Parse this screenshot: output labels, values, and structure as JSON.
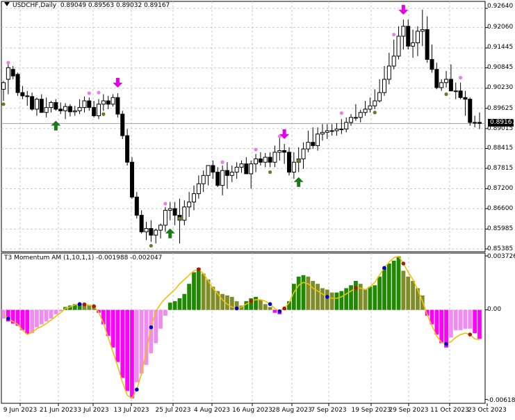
{
  "main_title": {
    "symbol_label": "USDCHF,Daily",
    "ohlc": "0.89049 0.89563 0.89032 0.89167"
  },
  "indicator_title": {
    "name": "T3 Momentum AM (1,10,1,1)",
    "values": "-0.001988 -0.002047"
  },
  "price_axis_labels": [
    "0.92640",
    "0.92060",
    "0.91445",
    "0.90845",
    "0.90230",
    "0.89625",
    "0.89015",
    "0.88415",
    "0.87815",
    "0.87200",
    "0.86600",
    "0.85985",
    "0.85385"
  ],
  "current_price_label": "0.89167",
  "indicator_axis_labels": [
    "0.003726",
    "0.00",
    "-0.00618"
  ],
  "x_axis_labels": [
    "9 Jun 2023",
    "21 Jun 2023",
    "3 Jul 2023",
    "13 Jul 2023",
    "25 Jul 2023",
    "4 Aug 2023",
    "16 Aug 2023",
    "28 Aug 2023",
    "7 Sep 2023",
    "19 Sep 2023",
    "29 Sep 2023",
    "11 Oct 2023",
    "23 Oct 2023"
  ],
  "colors": {
    "bull_candle": "#ffffff",
    "bear_candle": "#000000",
    "arrow_up": "#1a7a1a",
    "arrow_down": "#e600e6",
    "dot_pink": "#e87ee8",
    "dot_olive": "#6b7a2a",
    "hist_green": "#1f8a00",
    "hist_olive": "#7f8c2a",
    "hist_magenta": "#ff00ff",
    "hist_violet": "#f08cf0",
    "t3_line": "#f0c000",
    "dot_blue": "#0000cc",
    "dot_red": "#a02010"
  },
  "chart_data": [
    {
      "type": "candlestick",
      "title": "USDCHF,Daily",
      "ylim": [
        0.853,
        0.9285
      ],
      "x": [
        "2023-06-05",
        "2023-06-06",
        "2023-06-07",
        "2023-06-08",
        "2023-06-09",
        "2023-06-12",
        "2023-06-13",
        "2023-06-14",
        "2023-06-15",
        "2023-06-16",
        "2023-06-19",
        "2023-06-20",
        "2023-06-21",
        "2023-06-22",
        "2023-06-23",
        "2023-06-26",
        "2023-06-27",
        "2023-06-28",
        "2023-06-29",
        "2023-06-30",
        "2023-07-03",
        "2023-07-04",
        "2023-07-05",
        "2023-07-06",
        "2023-07-07",
        "2023-07-10",
        "2023-07-11",
        "2023-07-12",
        "2023-07-13",
        "2023-07-14",
        "2023-07-17",
        "2023-07-18",
        "2023-07-19",
        "2023-07-20",
        "2023-07-21",
        "2023-07-24",
        "2023-07-25",
        "2023-07-26",
        "2023-07-27",
        "2023-07-28",
        "2023-07-31",
        "2023-08-01",
        "2023-08-02",
        "2023-08-03",
        "2023-08-04",
        "2023-08-07",
        "2023-08-08",
        "2023-08-09",
        "2023-08-10",
        "2023-08-11",
        "2023-08-14",
        "2023-08-15",
        "2023-08-16",
        "2023-08-17",
        "2023-08-18",
        "2023-08-21",
        "2023-08-22",
        "2023-08-23",
        "2023-08-24",
        "2023-08-25",
        "2023-08-28",
        "2023-08-29",
        "2023-08-30",
        "2023-08-31",
        "2023-09-01",
        "2023-09-04",
        "2023-09-05",
        "2023-09-06",
        "2023-09-07",
        "2023-09-08",
        "2023-09-11",
        "2023-09-12",
        "2023-09-13",
        "2023-09-14",
        "2023-09-15",
        "2023-09-18",
        "2023-09-19",
        "2023-09-20",
        "2023-09-21",
        "2023-09-22",
        "2023-09-25",
        "2023-09-26",
        "2023-09-27",
        "2023-09-28",
        "2023-09-29",
        "2023-10-02",
        "2023-10-03",
        "2023-10-04",
        "2023-10-05",
        "2023-10-06",
        "2023-10-09",
        "2023-10-10",
        "2023-10-11",
        "2023-10-12",
        "2023-10-13",
        "2023-10-16",
        "2023-10-17",
        "2023-10-18",
        "2023-10-19",
        "2023-10-20",
        "2023-10-23"
      ],
      "open": [
        0.902,
        0.905,
        0.908,
        0.9065,
        0.901,
        0.9,
        0.8998,
        0.896,
        0.899,
        0.895,
        0.8965,
        0.898,
        0.896,
        0.8955,
        0.8968,
        0.8952,
        0.8955,
        0.8965,
        0.8985,
        0.8965,
        0.894,
        0.8975,
        0.8985,
        0.8975,
        0.8995,
        0.8945,
        0.888,
        0.88,
        0.8695,
        0.864,
        0.859,
        0.86,
        0.858,
        0.8595,
        0.861,
        0.8655,
        0.866,
        0.864,
        0.8625,
        0.8665,
        0.868,
        0.8705,
        0.8735,
        0.876,
        0.879,
        0.877,
        0.873,
        0.8775,
        0.876,
        0.877,
        0.8785,
        0.8795,
        0.8765,
        0.8795,
        0.881,
        0.88,
        0.8815,
        0.88,
        0.883,
        0.8835,
        0.883,
        0.877,
        0.88,
        0.881,
        0.884,
        0.886,
        0.885,
        0.8885,
        0.889,
        0.8895,
        0.8895,
        0.89,
        0.89,
        0.892,
        0.8935,
        0.8935,
        0.895,
        0.896,
        0.897,
        0.8985,
        0.901,
        0.905,
        0.909,
        0.912,
        0.918,
        0.921,
        0.915,
        0.916,
        0.9195,
        0.92,
        0.911,
        0.908,
        0.9025,
        0.904,
        0.905,
        0.9015,
        0.9015,
        0.8995,
        0.899,
        0.892,
        0.892
      ],
      "high": [
        0.9045,
        0.9095,
        0.909,
        0.907,
        0.903,
        0.9015,
        0.901,
        0.8995,
        0.9005,
        0.8995,
        0.8985,
        0.899,
        0.898,
        0.8978,
        0.8975,
        0.897,
        0.899,
        0.8998,
        0.8995,
        0.8985,
        0.899,
        0.9005,
        0.9,
        0.9005,
        0.9008,
        0.8955,
        0.89,
        0.8815,
        0.871,
        0.8655,
        0.862,
        0.8625,
        0.86,
        0.8615,
        0.8665,
        0.868,
        0.868,
        0.869,
        0.8685,
        0.871,
        0.873,
        0.876,
        0.8775,
        0.879,
        0.8805,
        0.8785,
        0.879,
        0.88,
        0.879,
        0.88,
        0.8805,
        0.8815,
        0.8805,
        0.8825,
        0.883,
        0.8828,
        0.883,
        0.885,
        0.888,
        0.8855,
        0.8845,
        0.883,
        0.8845,
        0.886,
        0.8895,
        0.8905,
        0.8905,
        0.8915,
        0.8915,
        0.8915,
        0.8918,
        0.893,
        0.8935,
        0.8945,
        0.8975,
        0.8958,
        0.8985,
        0.8995,
        0.902,
        0.905,
        0.909,
        0.913,
        0.917,
        0.921,
        0.923,
        0.923,
        0.92,
        0.921,
        0.926,
        0.924,
        0.9155,
        0.91,
        0.905,
        0.9075,
        0.9095,
        0.904,
        0.904,
        0.9015,
        0.8995,
        0.894,
        0.895
      ],
      "low": [
        0.8985,
        0.9005,
        0.905,
        0.9,
        0.899,
        0.897,
        0.8955,
        0.894,
        0.895,
        0.8935,
        0.895,
        0.8955,
        0.8945,
        0.893,
        0.8938,
        0.894,
        0.8945,
        0.895,
        0.8955,
        0.8935,
        0.893,
        0.8955,
        0.896,
        0.8968,
        0.8935,
        0.887,
        0.879,
        0.869,
        0.863,
        0.8585,
        0.8565,
        0.856,
        0.8555,
        0.857,
        0.859,
        0.8625,
        0.861,
        0.8555,
        0.861,
        0.8635,
        0.8655,
        0.869,
        0.871,
        0.873,
        0.875,
        0.8725,
        0.87,
        0.872,
        0.874,
        0.875,
        0.8768,
        0.8765,
        0.872,
        0.877,
        0.879,
        0.8785,
        0.8785,
        0.8785,
        0.8805,
        0.8795,
        0.876,
        0.875,
        0.877,
        0.878,
        0.883,
        0.884,
        0.8835,
        0.8865,
        0.887,
        0.888,
        0.888,
        0.8885,
        0.889,
        0.891,
        0.8925,
        0.892,
        0.894,
        0.895,
        0.896,
        0.898,
        0.9,
        0.9035,
        0.908,
        0.911,
        0.914,
        0.914,
        0.9115,
        0.912,
        0.915,
        0.91,
        0.907,
        0.902,
        0.9015,
        0.9025,
        0.9015,
        0.899,
        0.899,
        0.894,
        0.891,
        0.8905,
        0.89
      ],
      "close": [
        0.904,
        0.9085,
        0.906,
        0.901,
        0.9,
        0.8998,
        0.896,
        0.899,
        0.895,
        0.8965,
        0.898,
        0.896,
        0.8955,
        0.8968,
        0.8952,
        0.8955,
        0.8965,
        0.8985,
        0.8965,
        0.894,
        0.8975,
        0.8985,
        0.8975,
        0.8995,
        0.8945,
        0.888,
        0.88,
        0.8695,
        0.864,
        0.859,
        0.86,
        0.858,
        0.8595,
        0.861,
        0.8655,
        0.866,
        0.864,
        0.8625,
        0.8665,
        0.868,
        0.8705,
        0.8735,
        0.876,
        0.879,
        0.877,
        0.873,
        0.8775,
        0.876,
        0.877,
        0.8785,
        0.8795,
        0.8765,
        0.8795,
        0.881,
        0.88,
        0.8815,
        0.88,
        0.883,
        0.8835,
        0.883,
        0.877,
        0.88,
        0.881,
        0.884,
        0.886,
        0.885,
        0.8885,
        0.889,
        0.8895,
        0.8895,
        0.89,
        0.89,
        0.892,
        0.8935,
        0.8935,
        0.895,
        0.896,
        0.897,
        0.8985,
        0.901,
        0.905,
        0.909,
        0.912,
        0.918,
        0.921,
        0.915,
        0.916,
        0.9195,
        0.92,
        0.911,
        0.908,
        0.9025,
        0.904,
        0.905,
        0.9015,
        0.9015,
        0.8995,
        0.899,
        0.892,
        0.892,
        0.8917
      ],
      "arrows_up": [
        {
          "x": "2023-06-20",
          "price": 0.8925
        },
        {
          "x": "2023-07-24",
          "price": 0.86
        },
        {
          "x": "2023-08-30",
          "price": 0.8755
        }
      ],
      "arrows_down": [
        {
          "x": "2023-07-07",
          "price": 0.9025
        },
        {
          "x": "2023-08-25",
          "price": 0.887
        },
        {
          "x": "2023-09-29",
          "price": 0.9245
        }
      ],
      "dots_above": [
        {
          "x": "2023-06-06",
          "price": 0.91
        },
        {
          "x": "2023-06-29",
          "price": 0.9008
        },
        {
          "x": "2023-07-03",
          "price": 0.901
        },
        {
          "x": "2023-07-21",
          "price": 0.8675
        },
        {
          "x": "2023-08-08",
          "price": 0.88
        },
        {
          "x": "2023-08-17",
          "price": 0.8838
        },
        {
          "x": "2023-08-24",
          "price": 0.8878
        },
        {
          "x": "2023-09-12",
          "price": 0.8948
        },
        {
          "x": "2023-09-27",
          "price": 0.9185
        },
        {
          "x": "2023-10-17",
          "price": 0.9055
        }
      ],
      "dots_below": [
        {
          "x": "2023-06-05",
          "price": 0.8975
        },
        {
          "x": "2023-07-04",
          "price": 0.8945
        },
        {
          "x": "2023-07-18",
          "price": 0.8548
        },
        {
          "x": "2023-07-26",
          "price": 0.863
        },
        {
          "x": "2023-08-22",
          "price": 0.877
        },
        {
          "x": "2023-08-30",
          "price": 0.8805
        },
        {
          "x": "2023-09-21",
          "price": 0.895
        },
        {
          "x": "2023-10-12",
          "price": 0.9005
        }
      ],
      "current_price": 0.89167
    },
    {
      "type": "bar",
      "title": "T3 Momentum AM (1,10,1,1)",
      "ylim": [
        -0.00645,
        0.00392
      ],
      "values": [
        -0.0006,
        -0.0008,
        -0.00095,
        -0.0011,
        -0.0014,
        -0.00165,
        -0.0016,
        -0.0012,
        -0.001,
        -0.0008,
        -0.0006,
        -0.0003,
        -0.0001,
        0.0002,
        0.0003,
        0.0004,
        0.00045,
        0.0004,
        0.00035,
        0.0003,
        -0.0002,
        -0.001,
        -0.0018,
        -0.0026,
        -0.0036,
        -0.0047,
        -0.0056,
        -0.0061,
        -0.005,
        -0.0044,
        -0.0038,
        -0.003,
        -0.0023,
        -0.0013,
        -0.0004,
        0.0005,
        0.0006,
        0.0008,
        0.0011,
        0.0018,
        0.0026,
        0.0029,
        0.0025,
        0.0021,
        0.0016,
        0.0013,
        0.0011,
        0.001,
        0.0009,
        0.0006,
        0.0003,
        0.0006,
        0.0008,
        0.0009,
        0.0007,
        0.0004,
        0.0002,
        -0.0002,
        -0.0003,
        0.0001,
        0.0006,
        0.0018,
        0.0023,
        0.0024,
        0.0023,
        0.002,
        0.0018,
        0.0015,
        0.0014,
        0.0012,
        0.0012,
        0.0013,
        0.0015,
        0.0017,
        0.002,
        0.0018,
        0.0014,
        0.0016,
        0.0017,
        0.0023,
        0.0029,
        0.0032,
        0.0034,
        0.0037,
        0.0027,
        0.0023,
        0.002,
        0.0015,
        0.001,
        -0.0004,
        -0.001,
        -0.0017,
        -0.0023,
        -0.0026,
        -0.0019,
        -0.0014,
        -0.0014,
        -0.0013,
        -0.0013,
        -0.0016,
        -0.002
      ],
      "t3_line": [
        -0.0003,
        -0.0006,
        -0.0008,
        -0.001,
        -0.0014,
        -0.0017,
        -0.00155,
        -0.0013,
        -0.00115,
        -0.00095,
        -0.0007,
        -0.00045,
        -0.0002,
        0.0001,
        0.0002,
        0.00035,
        0.0004,
        0.00038,
        0.00032,
        0.00025,
        -0.00015,
        -0.0009,
        -0.0019,
        -0.0029,
        -0.0039,
        -0.005,
        -0.0059,
        -0.0061,
        -0.0055,
        -0.0044,
        -0.0029,
        -0.0012,
        -0.0001,
        0.0004,
        0.0008,
        0.0011,
        0.0014,
        0.0018,
        0.0021,
        0.0024,
        0.0027,
        0.0028,
        0.0025,
        0.002,
        0.0015,
        0.0011,
        0.0007,
        0.0004,
        0.0002,
        0.0001,
        0.0002,
        0.0004,
        0.0006,
        0.0007,
        0.0007,
        0.0006,
        0.0004,
        0.0001,
        -0.0001,
        0.0001,
        0.0005,
        0.0012,
        0.0017,
        0.0019,
        0.0018,
        0.0015,
        0.0013,
        0.0011,
        0.0009,
        0.0008,
        0.0008,
        0.0009,
        0.0011,
        0.0013,
        0.0015,
        0.0015,
        0.0014,
        0.0016,
        0.0019,
        0.0024,
        0.0029,
        0.0033,
        0.0036,
        0.0037,
        0.0032,
        0.0026,
        0.0021,
        0.0014,
        0.0006,
        -0.0003,
        -0.0011,
        -0.0018,
        -0.00225,
        -0.00235,
        -0.0022,
        -0.0019,
        -0.0017,
        -0.0016,
        -0.0017,
        -0.002,
        -0.00205
      ],
      "dots_blue": [
        1,
        16,
        28,
        31,
        49,
        56,
        58,
        68,
        80,
        93
      ],
      "dots_red": [
        17,
        19,
        41,
        52,
        59,
        74,
        84,
        98
      ]
    }
  ]
}
